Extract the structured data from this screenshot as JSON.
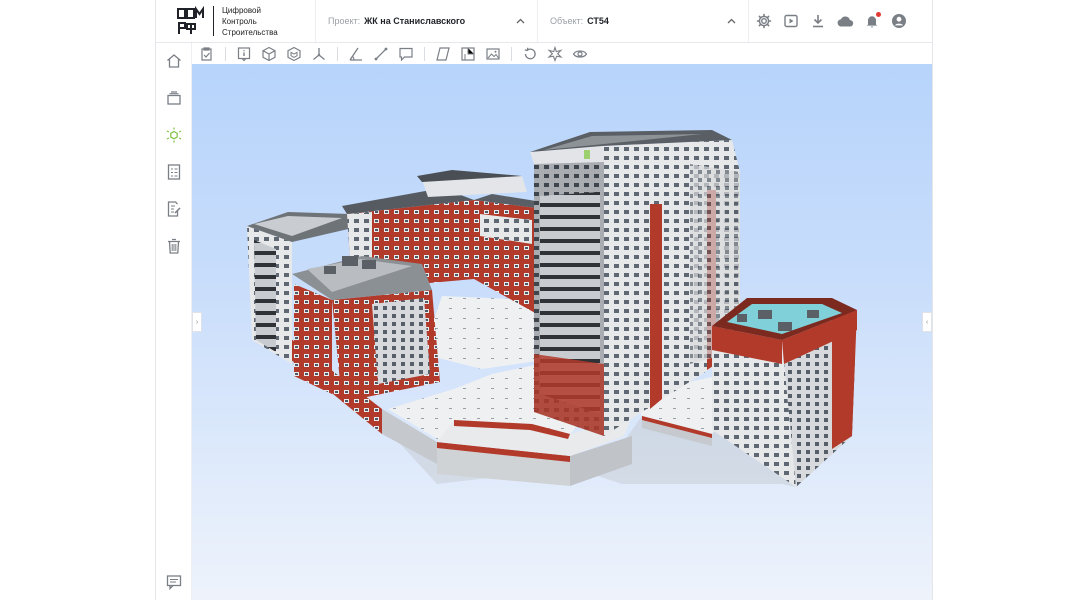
{
  "logo": {
    "line1": "Цифровой",
    "line2": "Контроль",
    "line3": "Строительства"
  },
  "project": {
    "label": "Проект:",
    "value": "ЖК на Станиславского"
  },
  "object": {
    "label": "Объект:",
    "value": "СТ54"
  },
  "header_icons": [
    "gear-icon",
    "video-play-icon",
    "download-icon",
    "cloud-icon",
    "bell-icon",
    "account-icon"
  ],
  "left_nav": [
    "home-icon",
    "layers-icon",
    "model-icon",
    "checklist-icon",
    "edit-document-icon",
    "trash-icon",
    "chat-icon"
  ],
  "toolbar_icons": [
    "report-check-icon",
    "info-icon",
    "cube-icon",
    "section-cube-icon",
    "axes-icon",
    "angle-measure-icon",
    "distance-measure-icon",
    "comment-icon",
    "plane-icon",
    "floor-plan-icon",
    "image-icon",
    "reset-view-icon",
    "explode-icon",
    "visibility-icon"
  ],
  "colors": {
    "accent": "#7cc242",
    "notification": "#e53935",
    "sky_top": "#b7d4fb",
    "sky_bottom": "#eef3fb",
    "facade_red": "#b23a2a"
  }
}
